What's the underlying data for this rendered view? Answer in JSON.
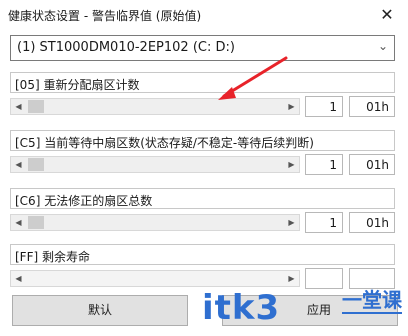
{
  "window": {
    "title": "健康状态设置 - 警告临界值 (原始值)",
    "close_glyph": "✕"
  },
  "disk_select": {
    "value": "(1) ST1000DM010-2EP102  (C: D:)"
  },
  "attributes": [
    {
      "label": "[05] 重新分配扇区计数",
      "value": "1",
      "hex": "01h"
    },
    {
      "label": "[C5] 当前等待中扇区数(状态存疑/不稳定-等待后续判断)",
      "value": "1",
      "hex": "01h"
    },
    {
      "label": "[C6] 无法修正的扇区总数",
      "value": "1",
      "hex": "01h"
    },
    {
      "label": "[FF] 剩余寿命",
      "value": "",
      "hex": ""
    }
  ],
  "buttons": {
    "default": "默认",
    "apply": "应用"
  },
  "watermark": {
    "main": "itk3",
    "sub": "一堂课"
  },
  "colors": {
    "annotation_arrow": "#e8232a",
    "watermark": "#2f6fd0"
  }
}
